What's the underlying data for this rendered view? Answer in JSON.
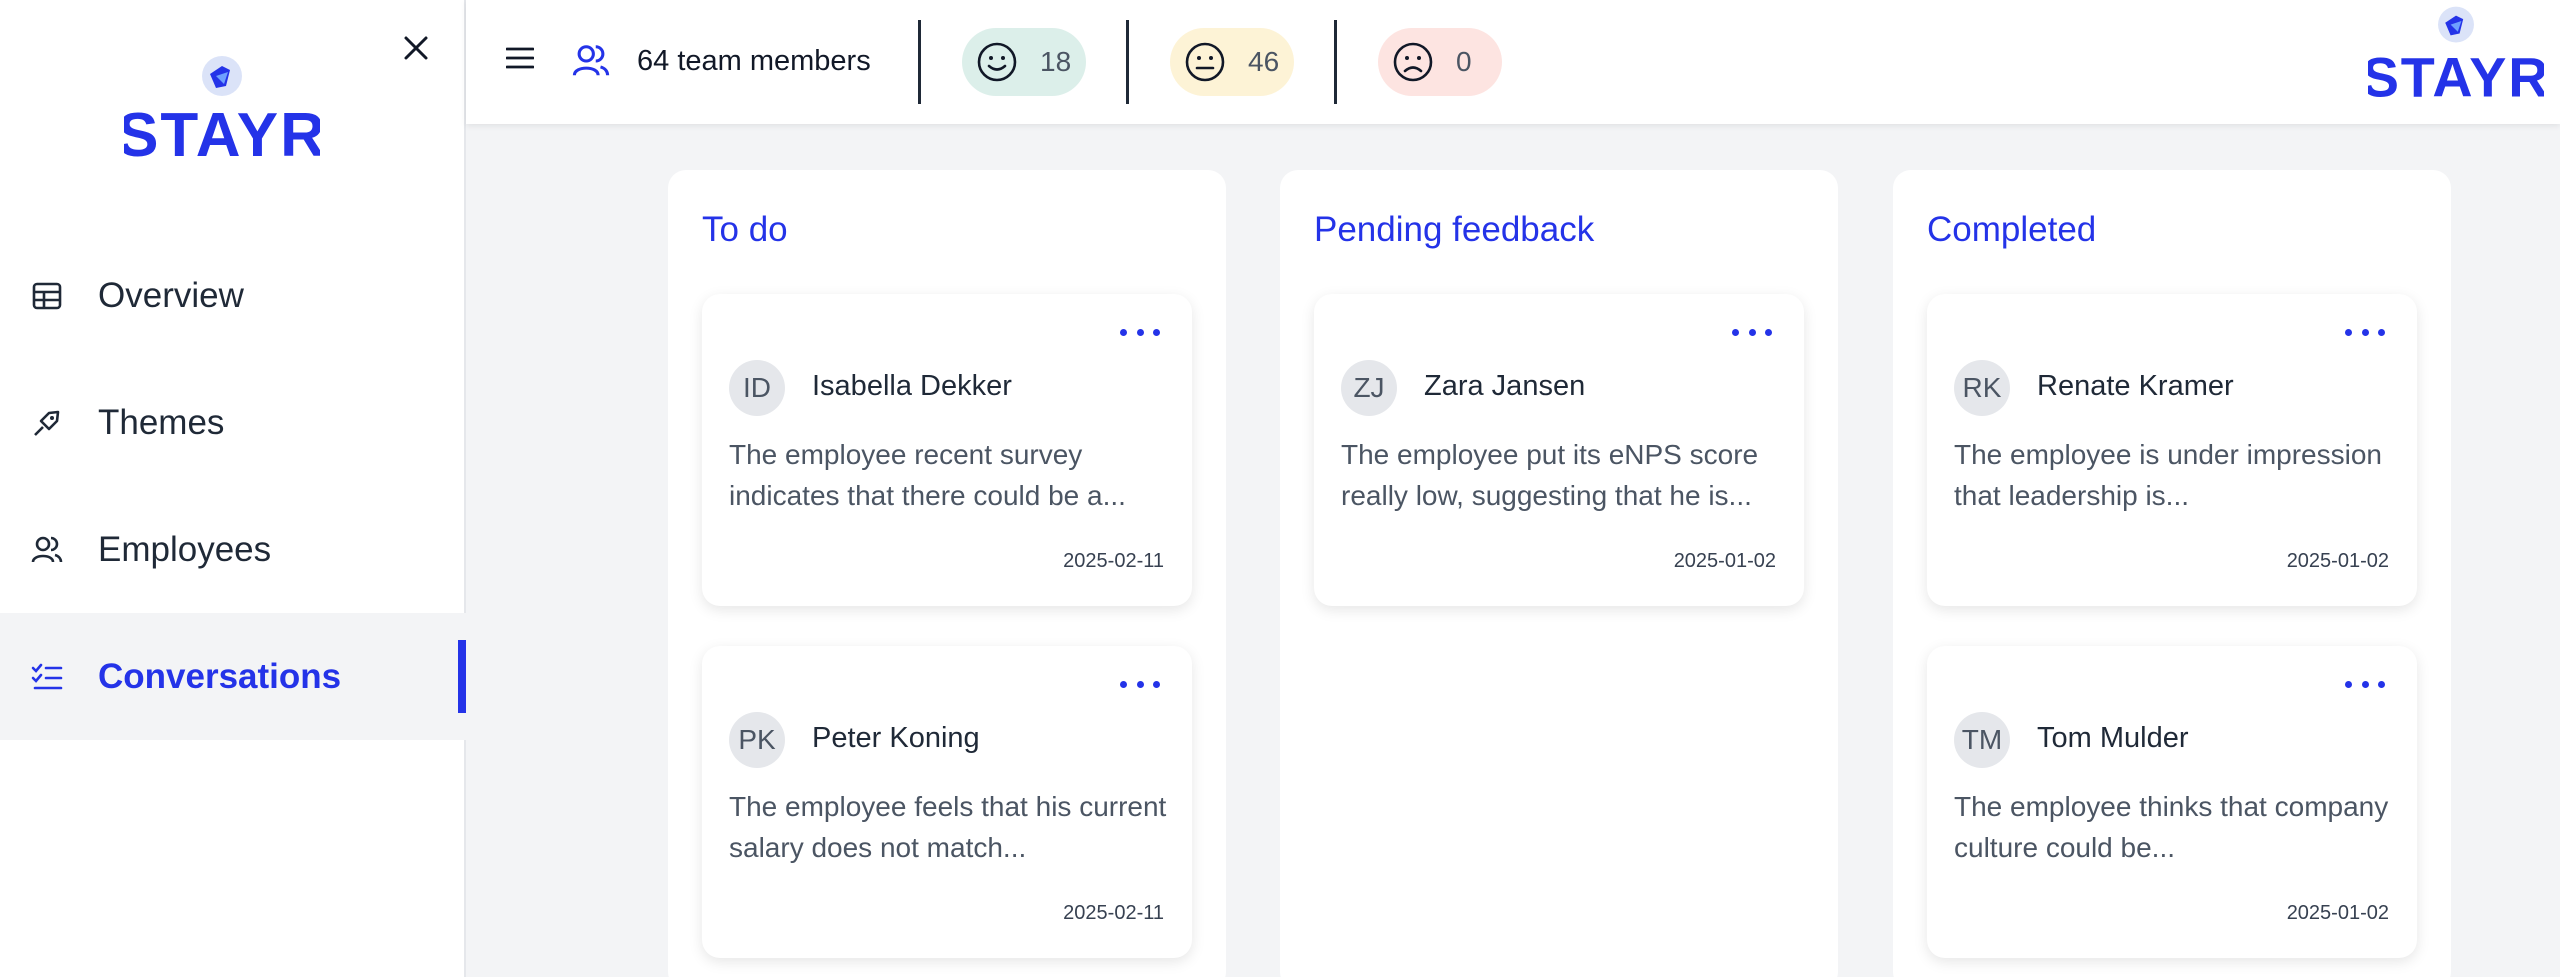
{
  "brand": {
    "logo_text": "STAYR",
    "accent": "#2433e8"
  },
  "sidebar": {
    "items": [
      {
        "label": "Overview",
        "icon": "table-icon"
      },
      {
        "label": "Themes",
        "icon": "tag-icon"
      },
      {
        "label": "Employees",
        "icon": "users-icon"
      },
      {
        "label": "Conversations",
        "icon": "checklist-icon",
        "active": true
      }
    ]
  },
  "topbar": {
    "team_label": "64 team members",
    "happy_count": "18",
    "neutral_count": "46",
    "sad_count": "0",
    "colors": {
      "happy": "#dcefea",
      "neutral": "#fdf3d6",
      "sad": "#fde4e1"
    }
  },
  "board": {
    "columns": [
      {
        "title": "To do",
        "cards": [
          {
            "initials": "ID",
            "name": "Isabella Dekker",
            "desc": "The employee recent survey indicates that there could be a...",
            "date": "2025-02-11"
          },
          {
            "initials": "PK",
            "name": "Peter Koning",
            "desc": "The employee feels that his current salary does not match...",
            "date": "2025-02-11"
          }
        ]
      },
      {
        "title": "Pending feedback",
        "cards": [
          {
            "initials": "ZJ",
            "name": "Zara Jansen",
            "desc": "The employee put its eNPS score really low, suggesting that he is...",
            "date": "2025-01-02"
          }
        ]
      },
      {
        "title": "Completed",
        "cards": [
          {
            "initials": "RK",
            "name": "Renate Kramer",
            "desc": "The employee is under impression that leadership is...",
            "date": "2025-01-02"
          },
          {
            "initials": "TM",
            "name": "Tom Mulder",
            "desc": "The employee thinks that company culture could be...",
            "date": "2025-01-02"
          }
        ]
      }
    ]
  }
}
